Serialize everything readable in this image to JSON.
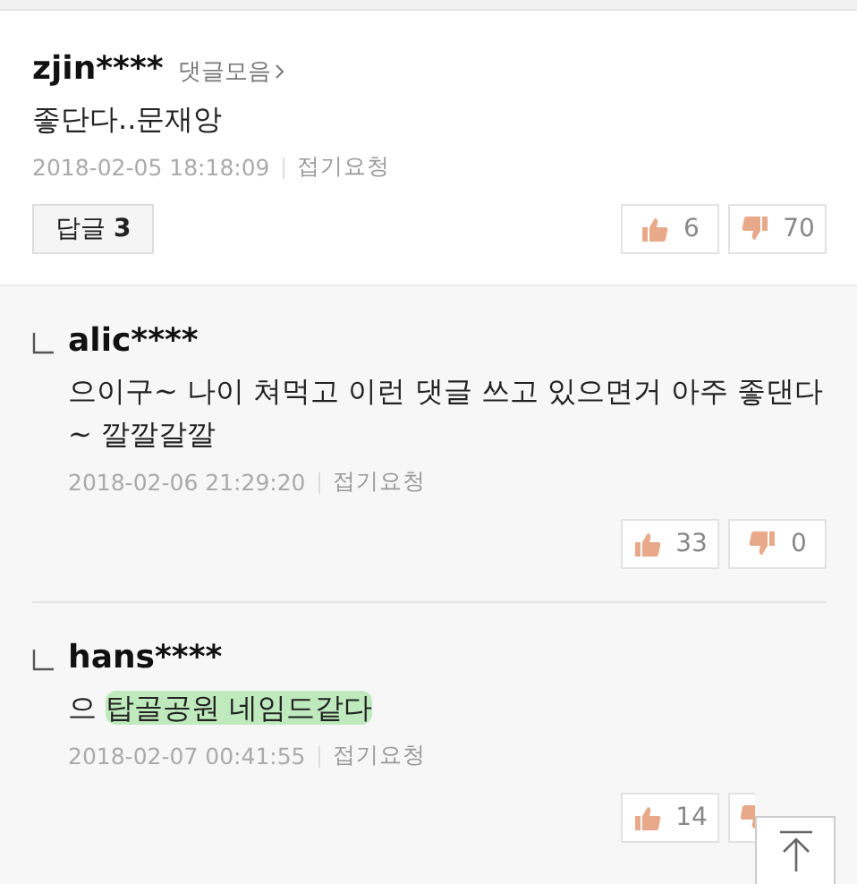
{
  "comment": {
    "author": "zjin****",
    "collection_link": "댓글모음",
    "content": "좋단다..문재앙",
    "date": "2018-02-05 18:18:09",
    "report": "접기요청",
    "reply_button": {
      "label": "답글",
      "count": "3"
    },
    "likes": "6",
    "dislikes": "70"
  },
  "replies": [
    {
      "author": "alic****",
      "content": [
        {
          "text": "으이구~ 나이 쳐먹고 이런 댓글 쓰고 있으면거 아주 좋댄다 ~ 깔깔갈깔",
          "highlighted": false
        }
      ],
      "date": "2018-02-06 21:29:20",
      "report": "접기요청",
      "likes": "33",
      "dislikes": "0"
    },
    {
      "author": "hans****",
      "content": [
        {
          "text": "으 ",
          "highlighted": false
        },
        {
          "text": "탑골공원 네임드같다",
          "highlighted": true
        }
      ],
      "date": "2018-02-07 00:41:55",
      "report": "접기요청",
      "likes": "14"
    }
  ]
}
